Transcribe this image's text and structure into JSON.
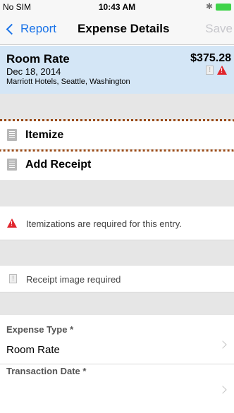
{
  "status_bar": {
    "carrier": "No SIM",
    "time": "10:43 AM",
    "bluetooth": "✱"
  },
  "nav": {
    "back_label": "Report",
    "title": "Expense Details",
    "save_label": "Save"
  },
  "expense": {
    "name": "Room Rate",
    "date": "Dec 18, 2014",
    "vendor": "Marriott Hotels, Seattle, Washington",
    "amount": "$375.28"
  },
  "actions": {
    "itemize": "Itemize",
    "add_receipt": "Add Receipt"
  },
  "messages": {
    "itemization_required": "Itemizations are required for this entry.",
    "receipt_required": "Receipt image required"
  },
  "fields": {
    "expense_type_label": "Expense Type *",
    "expense_type_value": "Room Rate",
    "transaction_date_label": "Transaction Date *"
  },
  "colors": {
    "accent": "#1a73e8",
    "summary_bg": "#d4e6f6",
    "warning": "#e0242c",
    "highlight": "#9a4a16"
  }
}
